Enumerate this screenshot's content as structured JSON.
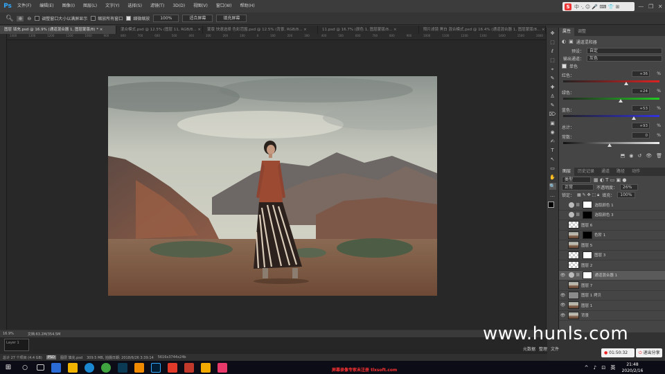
{
  "app": {
    "logo": "Ps"
  },
  "menu": [
    "文件(F)",
    "编辑(E)",
    "图像(I)",
    "图层(L)",
    "文字(Y)",
    "选择(S)",
    "滤镜(T)",
    "3D(D)",
    "视图(V)",
    "窗口(W)",
    "帮助(H)"
  ],
  "ime": {
    "logo": "S",
    "glyphs": "中 ·, ☺ 🎤 ⌨ 👕 ⊞"
  },
  "window_controls": [
    "—",
    "❐",
    "✕"
  ],
  "options_bar": {
    "check1": "调整窗口大小以满屏显示",
    "check2": "缩放所有窗口",
    "check3": "细微缩放",
    "zoom_value": "100%",
    "btn_fit": "适合屏幕",
    "btn_fill": "填充屏幕"
  },
  "doc_tabs": [
    "图层 填充.psd @ 16.9% (通道混合器 1, 图层蒙版/8) * ×",
    "混合模式.psd @ 12.5% (图层 11, RGB/8...  ×",
    "蒙版 快速选择 色彩范围.psd @ 12.5% (背景, RGB/8...  ×",
    "11.psd @ 16.7% (颜色 1, 图层蒙版/8...  ×",
    "照片滤镜 黑白 混合模式.psd @ 16.4% (通道混合器 1, 图层蒙版/8...  ×"
  ],
  "ruler_ticks": [
    "1400",
    "1300",
    "1200",
    "1100",
    "1000",
    "900",
    "800",
    "700",
    "600",
    "500",
    "400",
    "300",
    "200",
    "100",
    "0",
    "100",
    "200",
    "300",
    "400",
    "500",
    "600",
    "700",
    "800",
    "900",
    "1000",
    "1100",
    "1200",
    "1300",
    "1400",
    "1500",
    "1600"
  ],
  "status": {
    "zoom": "16.9%",
    "doc": "文档:63.2M/354.5M"
  },
  "timeline": {
    "label": "Layer 1"
  },
  "bottom_info": {
    "text1": "总计 27 个项目 (4.4 GB)",
    "text2": "PSD",
    "text3": "图层 填充.psd",
    "text4": "309.5 MB, 拍摄日期: 2018/6/26 3:39:14",
    "text5": "5616x3744x24b"
  },
  "tools": [
    "✥",
    "⬚",
    "ℓ",
    "⬚",
    "⌖",
    "✎",
    "✚",
    "♙",
    "✎",
    "⌦",
    "▣",
    "◉",
    "✍",
    "T",
    "↖",
    "▭",
    "✋",
    "🔍",
    "…"
  ],
  "properties": {
    "tabs": [
      "属性",
      "调整"
    ],
    "title": "通道混和器",
    "preset_label": "预设：",
    "preset_value": "自定",
    "output_label": "输出通道：",
    "output_value": "灰色",
    "mono": "单色",
    "sliders": [
      {
        "label": "红色：",
        "value": "+36",
        "pct": "%",
        "fraction": 0.68
      },
      {
        "label": "绿色：",
        "value": "+24",
        "pct": "%",
        "fraction": 0.62
      },
      {
        "label": "蓝色：",
        "value": "+53",
        "pct": "%",
        "fraction": 0.76
      },
      {
        "label": "总计：",
        "value": "+93",
        "pct": "%"
      },
      {
        "label": "常数：",
        "value": "0",
        "pct": "%",
        "fraction": 0.5
      }
    ],
    "pct_sign": "%"
  },
  "layers_panel": {
    "tabs": [
      "图层",
      "历史记录",
      "通道",
      "路径",
      "动作"
    ],
    "kind_label": "类型",
    "blend": "正常",
    "opacity_label": "不透明度：",
    "opacity": "26%",
    "lock_label": "锁定：",
    "fill_label": "填充：",
    "fill": "100%",
    "layers": [
      {
        "name": "选取颜色 1",
        "visible": false,
        "active": false,
        "type": "adj",
        "mask": "#ffffff"
      },
      {
        "name": "选取颜色 3",
        "visible": false,
        "active": false,
        "type": "adj",
        "mask": "#000000"
      },
      {
        "name": "图层 6",
        "visible": false,
        "active": false,
        "type": "pixel",
        "thumb": "checker"
      },
      {
        "name": "色阶 1",
        "visible": false,
        "active": false,
        "type": "pixel",
        "thumb": "photo",
        "mask": "#000000"
      },
      {
        "name": "图层 5",
        "visible": false,
        "active": false,
        "type": "pixel",
        "thumb": "photo"
      },
      {
        "name": "图层 3",
        "visible": false,
        "active": false,
        "type": "pixel",
        "thumb": "checker",
        "mask": "#ffffff"
      },
      {
        "name": "图层 2",
        "visible": false,
        "active": false,
        "type": "pixel",
        "thumb": "checker"
      },
      {
        "name": "通道混合器 1",
        "visible": true,
        "active": true,
        "type": "adj",
        "mask": "#ffffff"
      },
      {
        "name": "图层 7",
        "visible": false,
        "active": false,
        "type": "pixel",
        "thumb": "photo"
      },
      {
        "name": "图层 1 拷贝",
        "visible": true,
        "active": false,
        "type": "pixel",
        "thumb": "gray"
      },
      {
        "name": "图层 1",
        "visible": true,
        "active": false,
        "type": "pixel",
        "thumb": "photo"
      },
      {
        "name": "背景",
        "visible": true,
        "active": false,
        "type": "pixel",
        "thumb": "photo"
      }
    ]
  },
  "right_bottom_tabs": [
    "元数据",
    "整理",
    "文件"
  ],
  "watermark": "www.hunls.com",
  "record": {
    "time": "01:50:32",
    "share": "退出分享"
  },
  "taskbar": {
    "site": "屏幕录像专家未注册 tlxsoft.com",
    "clock_time": "21:48",
    "clock_date": "2020/2/16",
    "tray": [
      "^",
      "♪",
      "⊡",
      "英"
    ]
  }
}
